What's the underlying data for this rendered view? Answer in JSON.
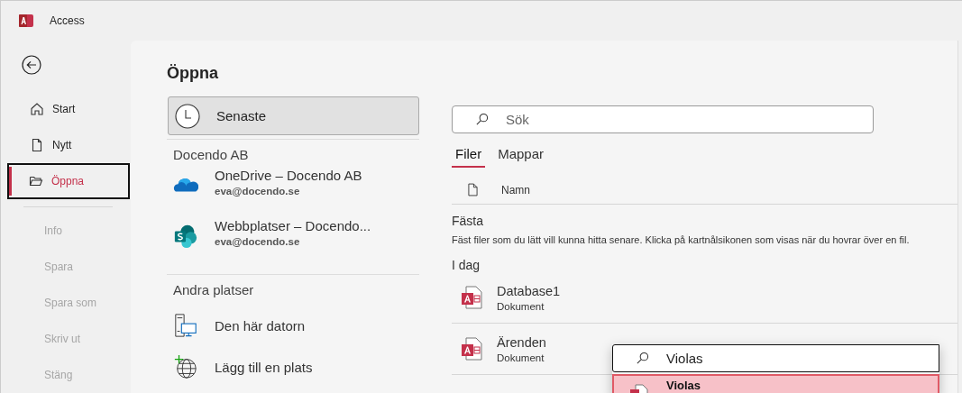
{
  "window": {
    "title": "Access"
  },
  "sidebar": {
    "items": [
      {
        "label": "Start",
        "selected": false,
        "disabled": false
      },
      {
        "label": "Nytt",
        "selected": false,
        "disabled": false
      },
      {
        "label": "Öppna",
        "selected": true,
        "disabled": false
      }
    ],
    "commands": [
      {
        "label": "Info",
        "disabled": true
      },
      {
        "label": "Spara",
        "disabled": true
      },
      {
        "label": "Spara som",
        "disabled": true
      },
      {
        "label": "Skriv ut",
        "disabled": true
      },
      {
        "label": "Stäng",
        "disabled": true
      }
    ]
  },
  "page": {
    "title": "Öppna",
    "recent": {
      "label": "Senaste",
      "selected": true
    },
    "sections": [
      {
        "heading": "Docendo AB",
        "places": [
          {
            "kind": "onedrive",
            "name": "OneDrive – Docendo AB",
            "account": "eva@docendo.se"
          },
          {
            "kind": "sharepoint",
            "name": "Webbplatser – Docendo...",
            "account": "eva@docendo.se"
          }
        ]
      },
      {
        "heading": "Andra platser",
        "places": [
          {
            "kind": "computer",
            "name": "Den här datorn"
          },
          {
            "kind": "addplace",
            "name": "Lägg till en plats"
          }
        ]
      }
    ]
  },
  "files": {
    "search": {
      "placeholder": "Sök"
    },
    "tabs": [
      {
        "label": "Filer",
        "selected": true
      },
      {
        "label": "Mappar",
        "selected": false
      }
    ],
    "column": "Namn",
    "pinned": {
      "heading": "Fästa",
      "hint": "Fäst filer som du lätt vill kunna hitta senare. Klicka på kartnålsikonen som visas när du hovrar över en fil."
    },
    "today": {
      "heading": "I dag",
      "items": [
        {
          "name": "Database1",
          "type": "Dokument"
        },
        {
          "name": "Ärenden",
          "type": "Dokument"
        }
      ]
    }
  },
  "popup": {
    "value": "Violas",
    "suggestions": [
      {
        "name": "Violas",
        "selected": true
      }
    ]
  }
}
